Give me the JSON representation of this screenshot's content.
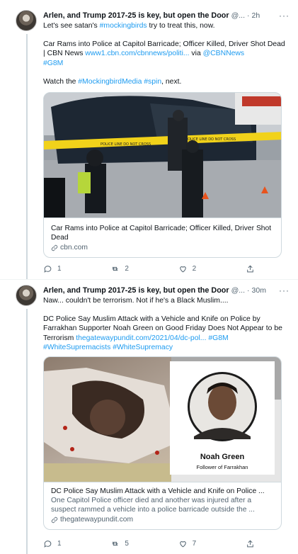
{
  "tweets": [
    {
      "name": "Arlen, and Trump 2017-25 is key, but open the Door",
      "handle": "@...",
      "dot": "·",
      "time": "2h",
      "more": "···",
      "text1_pre": "Let's see satan's ",
      "text1_link": "#mockingbirds",
      "text1_post": " try to treat this, now.",
      "text2_pre": "Car Rams into Police at Capitol Barricade; Officer Killed, Driver Shot Dead | CBN News ",
      "text2_url": "www1.cbn.com/cbnnews/politi...",
      "text2_via": " via ",
      "text2_mention": "@CBNNews",
      "text2_tag": "#G8M",
      "text3_pre": "Watch the ",
      "text3_tag1": "#MockingbirdMedia",
      "text3_tag2": "#spin",
      "text3_post": ", next.",
      "card": {
        "title": "Car Rams into Police at Capitol Barricade; Officer Killed, Driver Shot Dead",
        "domain": "cbn.com",
        "tape_text": "POLICE LINE DO NOT CROSS"
      },
      "actions": {
        "reply": "1",
        "retweet": "2",
        "like": "2"
      }
    },
    {
      "name": "Arlen, and Trump 2017-25 is key, but open the Door",
      "handle": "@...",
      "dot": "·",
      "time": "30m",
      "more": "···",
      "text1": "Naw... couldn't be terrorism. Not if he's a Black Muslim....",
      "text2_pre": "DC Police Say Muslim Attack with a Vehicle and Knife on Police by Farrakhan Supporter Noah Green on Good Friday Does Not Appear to be Terrorism ",
      "text2_url": "thegatewaypundit.com/2021/04/dc-pol...",
      "text2_tag1": "#G8M",
      "text2_tag2": "#WhiteSupremacists",
      "text2_tag3": "#WhiteSupremacy",
      "card": {
        "title": "DC Police Say Muslim Attack with a Vehicle and Knife on Police ...",
        "desc": "One Capitol Police officer died and another was injured after a suspect rammed a vehicle into a police barricade outside the ...",
        "domain": "thegatewaypundit.com",
        "inset_name": "Noah Green",
        "inset_sub": "Follower of Farrakhan"
      },
      "actions": {
        "reply": "1",
        "retweet": "5",
        "like": "7"
      }
    }
  ]
}
